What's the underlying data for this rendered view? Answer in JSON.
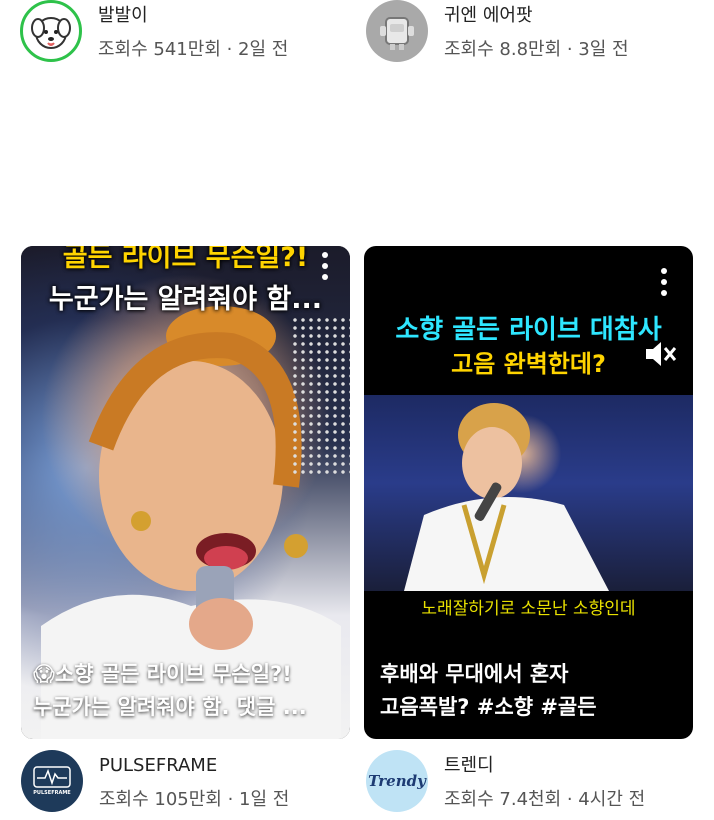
{
  "top_row": [
    {
      "channel": "발발이",
      "stats": "조회수 541만회 · 2일 전",
      "avatar_icon": "puppy-icon",
      "avatar_bg": "#ffffff",
      "avatar_border": "#2ec24a"
    },
    {
      "channel": "귀엔 에어팟",
      "stats": "조회수 8.8만회 · 3일 전",
      "avatar_icon": "robot-toy-icon",
      "avatar_bg": "#a9a9a9"
    }
  ],
  "cards": [
    {
      "top_caption_1": "골든 라이브 무슨일?!",
      "top_caption_2": "누군가는 알려줘야 함...",
      "title_emoji": "😱",
      "title_line1": "소향 골든 라이브 무슨일?!",
      "title_line2": "누군가는 알려줘야 함. 댓글 ...",
      "channel": "PULSEFRAME",
      "stats": "조회수 105만회 · 1일 전",
      "avatar_text": "PULSEFRAME",
      "avatar_bg": "#1e3a5a"
    },
    {
      "top_caption_1": "소향 골든 라이브 대참사",
      "top_caption_2": "고음 완벽한데?",
      "subtitle": "노래잘하기로 소문난 소향인데",
      "title_line1": "후배와 무대에서 혼자",
      "title_line2": "고음폭발? #소향 #골든",
      "channel": "트렌디",
      "stats": "조회수 7.4천회 · 4시간 전",
      "avatar_text": "Trendy",
      "avatar_bg": "#bfe3f5"
    }
  ],
  "colors": {
    "caption_yellow": "#ffd400",
    "caption_cyan": "#2ee6ff",
    "subtitle_yellow": "#e8e000"
  }
}
